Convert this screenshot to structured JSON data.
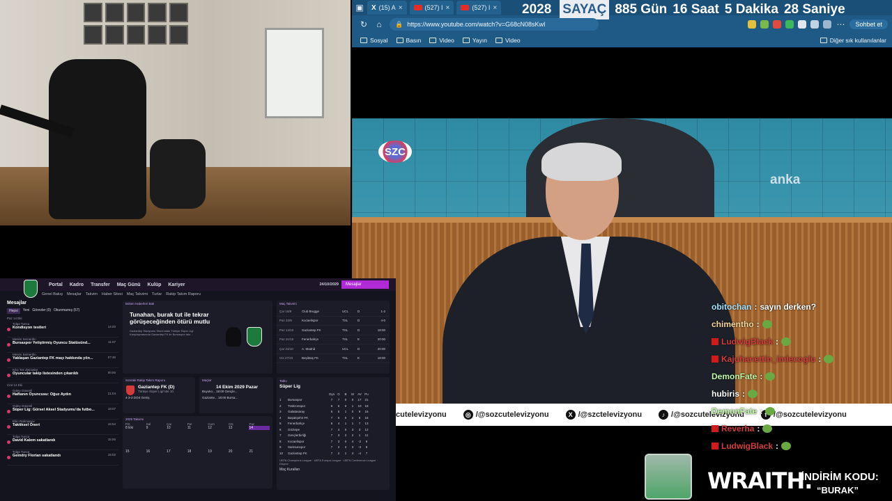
{
  "browser": {
    "tabs": [
      {
        "label": "(15) A",
        "icon": "x-icon"
      },
      {
        "label": "(527) I",
        "icon": "youtube-icon"
      },
      {
        "label": "(527) I",
        "icon": "youtube-icon"
      },
      {
        "label": "(527) I",
        "icon": "youtube-icon"
      }
    ],
    "counter": {
      "year": "2028",
      "label": "SAYAÇ",
      "days": "885 Gün",
      "hours": "16 Saat",
      "minutes": "5 Dakika",
      "seconds": "28 Saniye"
    },
    "url": "https://www.youtube.com/watch?v=G68cN08sKwI",
    "chat_button": "Sohbet et",
    "bookmarks": [
      "Sosyal",
      "Basın",
      "Video",
      "Yayın",
      "Video"
    ],
    "bookmarks_other": "Diğer sık kullanılanlar"
  },
  "video": {
    "channel_logo": "SZC",
    "watermark": "anka",
    "ticker": [
      {
        "icon": "",
        "text": "cutelevizyonu"
      },
      {
        "icon": "instagram-icon",
        "text": "/@sozcutelevizyonu"
      },
      {
        "icon": "x-icon",
        "text": "/@szctelevizyonu"
      },
      {
        "icon": "tiktok-icon",
        "text": "/@sozcutelevizyonu"
      },
      {
        "icon": "facebook-icon",
        "text": "/@sozcutelevizyonu"
      }
    ]
  },
  "chat": [
    {
      "user": "obitochan",
      "message": "sayın derken?",
      "badge": false,
      "color": "#a6e3ff"
    },
    {
      "user": "chimentho",
      "message": "",
      "badge": false,
      "color": "#f4d79b"
    },
    {
      "user": "LudwigBlack",
      "message": "",
      "badge": true,
      "color": "#d23c3c"
    },
    {
      "user": "Kajuhanettin_imlecoglu",
      "message": "",
      "badge": true,
      "color": "#d23c3c"
    },
    {
      "user": "DemonFate",
      "message": "",
      "badge": false,
      "color": "#bff5a4"
    },
    {
      "user": "hubiris",
      "message": "",
      "badge": false,
      "color": "#ffffff"
    },
    {
      "user": "DemonFate",
      "message": "",
      "badge": false,
      "color": "#bff5a4"
    },
    {
      "user": "Reverha",
      "message": "",
      "badge": true,
      "color": "#d23c3c"
    },
    {
      "user": "LudwigBlack",
      "message": "",
      "badge": true,
      "color": "#d23c3c"
    }
  ],
  "sponsor": {
    "brand": "WRAITH.",
    "promo_label": "İNDİRİM KODU:",
    "promo_code": "“BURAK”"
  },
  "fm": {
    "nav": [
      "Portal",
      "Kadro",
      "Transfer",
      "Maç Günü",
      "Kulüp",
      "Kariyer"
    ],
    "subnav": [
      "Genel Bakış",
      "Mesajlar",
      "Takvim",
      "Haber Sitesi",
      "Maç Takvimi",
      "Turlar",
      "Rakip Takım Raporu"
    ],
    "date": "24/10/2029",
    "messages_button": "Mesajlar",
    "inbox_title": "Mesajlar",
    "filters": [
      "Hepsi",
      "Yeni",
      "Görevler (0)",
      "Okunmamış (57)"
    ],
    "inbox": [
      {
        "date": "Paz 14 Eki",
        "from": "Tolga Tunca",
        "subject": "Kondisyon testleri",
        "time": "14:00"
      },
      {
        "date": "",
        "from": "Mesim Semerdin",
        "subject": "Bursaspor Yetiştirmiş Oyuncu Statüsünd...",
        "time": "11:07"
      },
      {
        "date": "",
        "from": "Mesim Semerdin",
        "subject": "Yaklaşan Gaziantep FK maçı hakkında yön...",
        "time": "07:46"
      },
      {
        "date": "",
        "from": "Kılıç Toz Zinj'anlar",
        "subject": "Oyuncular takip listesinden çıkarıldı",
        "time": "00:00"
      },
      {
        "date": "Cmt 13 Eki",
        "from": "Güley Güvenli",
        "subject": "Haftanın Oyuncusu: Oğuz Aydın",
        "time": "21:04"
      },
      {
        "date": "",
        "from": "Güley Güvenli",
        "subject": "Süper Lig: Gürsel Aksel Stadyumu'da futbo...",
        "time": "18:07"
      },
      {
        "date": "",
        "from": "Ekin Rahmanov",
        "subject": "Taktiksel Öneri",
        "time": "16:54"
      },
      {
        "date": "",
        "from": "Tolga Tunca",
        "subject": "David Kalem sakatlandı",
        "time": "15:00"
      },
      {
        "date": "",
        "from": "Tolga Tunca",
        "subject": "Geindry Florian sakatlandı",
        "time": "15:02"
      }
    ],
    "feature_header": "Bölüm Haberleri Bak",
    "feature_title": "Tunahan, burak tut ile tekrar görüşeceğinden ötürü mutlu",
    "feature_desc": "Gaziantep Stadyumu Stadı'ndaki Türkiye Süper Ligi Karşılaşmasında Gaziantep FK ile Bursaspor takı...",
    "fixtures_header": "Maç Takvimi",
    "fixtures": [
      {
        "date": "Çar 18/9",
        "team": "Club Brugge",
        "comp": "UCL",
        "venue": "D",
        "res": "1-2"
      },
      {
        "date": "Paz 22/9",
        "team": "Kocaelispor",
        "comp": "TSL",
        "venue": "D",
        "res": "4-0"
      },
      {
        "date": "Paz 14/10",
        "team": "Gaziantep FK",
        "comp": "TSL",
        "venue": "D",
        "res": "18:00"
      },
      {
        "date": "Paz 21/10",
        "team": "Fenerbahçe",
        "comp": "TSL",
        "venue": "E",
        "res": "20:00"
      },
      {
        "date": "Çar 24/10",
        "team": "A. Madrid",
        "comp": "UCL",
        "venue": "D",
        "res": "20:00"
      },
      {
        "date": "Cts 27/10",
        "team": "Beşiktaş FK",
        "comp": "TSL",
        "venue": "E",
        "res": "18:00"
      }
    ],
    "next_header": "Sonraki Rakip Takım Raporu",
    "next_team": "Gaziantep FK (D)",
    "next_team_sub": "Türkiye Süper Ligi'nde 10.",
    "next_form": "4-3-3 DOS Geniş",
    "match_header": "Maçlar",
    "match_date": "14 Ekim 2029 Pazar",
    "match_lines": [
      "Buyuko... 18:00 Gençle...",
      "Gaziante... 18:00 Bursa..."
    ],
    "calendar_header": "2029 Takvimi",
    "calendar_days": [
      "Pzt",
      "Sal",
      "Çar",
      "Per",
      "Cum",
      "Cts",
      "Paz"
    ],
    "calendar_rows": [
      [
        "8 Eki",
        "9",
        "10",
        "11",
        "12",
        "13",
        "14"
      ],
      [
        "15",
        "16",
        "17",
        "18",
        "19",
        "20",
        "21"
      ]
    ],
    "league_header": "Süper Lig",
    "league_cols": [
      "Oyn",
      "G",
      "B",
      "M",
      "AV",
      "Pu"
    ],
    "league": [
      {
        "pos": "1",
        "team": "Bursaspor",
        "vals": [
          "7",
          "7",
          "0",
          "0",
          "17",
          "21"
        ]
      },
      {
        "pos": "2",
        "team": "Trabzonspor",
        "vals": [
          "6",
          "6",
          "0",
          "1",
          "10",
          "18"
        ]
      },
      {
        "pos": "3",
        "team": "Galatasaray",
        "vals": [
          "6",
          "5",
          "1",
          "0",
          "9",
          "16"
        ]
      },
      {
        "pos": "4",
        "team": "Başakşehir FK",
        "vals": [
          "7",
          "5",
          "0",
          "2",
          "8",
          "15"
        ]
      },
      {
        "pos": "5",
        "team": "Fenerbahçe",
        "vals": [
          "6",
          "4",
          "1",
          "1",
          "7",
          "13"
        ]
      },
      {
        "pos": "6",
        "team": "Göztepe",
        "vals": [
          "7",
          "4",
          "0",
          "3",
          "3",
          "12"
        ]
      },
      {
        "pos": "7",
        "team": "Gençlerbirliği",
        "vals": [
          "7",
          "3",
          "2",
          "2",
          "1",
          "11"
        ]
      },
      {
        "pos": "8",
        "team": "Kocaelispor",
        "vals": [
          "7",
          "3",
          "0",
          "4",
          "-2",
          "9"
        ]
      },
      {
        "pos": "9",
        "team": "Samsunspor",
        "vals": [
          "7",
          "2",
          "2",
          "3",
          "-3",
          "8"
        ]
      },
      {
        "pos": "10",
        "team": "Gaziantep FK",
        "vals": [
          "7",
          "2",
          "1",
          "4",
          "-4",
          "7"
        ]
      }
    ],
    "league_footer": [
      "UEFA Champions League",
      "UEFA Europa League",
      "UEFA Conference League",
      "Düşme"
    ],
    "league_link": "Maç Kuralları"
  }
}
